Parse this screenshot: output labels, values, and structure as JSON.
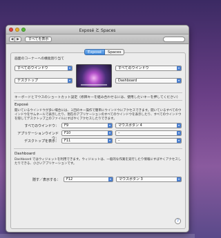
{
  "window": {
    "title": "Exposé と Spaces"
  },
  "toolbar": {
    "back_icon": "◀",
    "forward_icon": "▶",
    "show_all_label": "すべてを表示"
  },
  "tabs": [
    {
      "label": "Exposé",
      "active": true
    },
    {
      "label": "Spaces",
      "active": false
    }
  ],
  "corners": {
    "heading": "画面のコーナーへの機能割り当て",
    "top_left": "すべてのウインドウ",
    "top_right": "すべてのウインドウ",
    "bottom_left": "デスクトップ",
    "bottom_right": "Dashboard"
  },
  "shortcuts": {
    "heading": "キーボードとマウスのショートカット設定（修飾キーを組み合わせるには、使用したいキーを押してください）"
  },
  "expose": {
    "title": "Exposé",
    "description": "開いているウインドウが多い場合には、１回のキー操作で簡単にウインドウにアクセスできます。開いているすべてのウインドウをサムネールで表示したり、現在のアプリケーションのすべてのウインドウを表示したり、すべてのウインドウを隠してデスクトップ上のファイルにすばやくアクセスしたりできます。",
    "rows": [
      {
        "label": "すべてのウインドウ：",
        "key": "F9",
        "mouse": "マウスボタン 4"
      },
      {
        "label": "アプリケーションウインドウ：",
        "key": "F10",
        "mouse": "–"
      },
      {
        "label": "デスクトップを表示：",
        "key": "F11",
        "mouse": "–"
      }
    ]
  },
  "dashboard": {
    "title": "Dashboard",
    "description": "Dashboard ではウィジェットを利用できます。ウィジェットは、一般的な作業を実行したり情報にすばやくアクセスしたりできる、小さいアプリケーションです。",
    "row": {
      "label": "隠す／表示する：",
      "key": "F12",
      "mouse": "マウスボタン 3"
    }
  },
  "help_label": "?",
  "colors": {
    "accent": "#3c86db",
    "window_bg": "#e6e6e6"
  }
}
